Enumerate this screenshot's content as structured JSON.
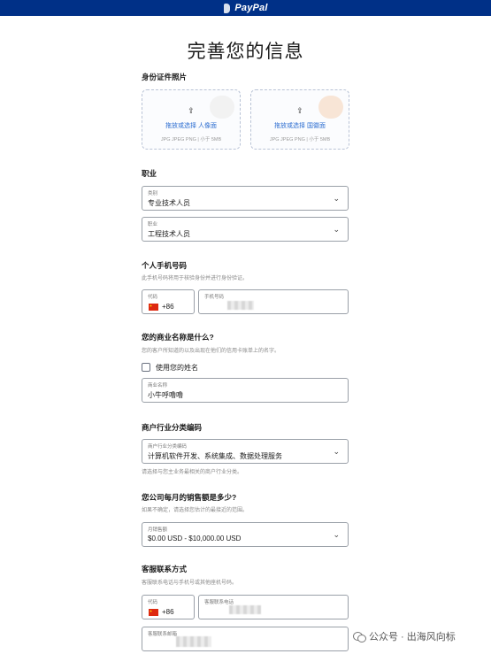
{
  "header": {
    "brand": "PayPal"
  },
  "page": {
    "title": "完善您的信息"
  },
  "id_photos": {
    "label": "身份证件照片",
    "front": {
      "link": "拖放或选择 人像面",
      "hint": "JPG JPEG PNG | 小于 5MB"
    },
    "back": {
      "link": "拖放或选择 国徽面",
      "hint": "JPG JPEG PNG | 小于 5MB"
    }
  },
  "occupation": {
    "label": "职业",
    "category": {
      "label": "类别",
      "value": "专业技术人员"
    },
    "job": {
      "label": "职业",
      "value": "工程技术人员"
    }
  },
  "phone": {
    "label": "个人手机号码",
    "helper": "此手机号码将用于核验身份并进行身份验证。",
    "code_label": "代码",
    "code_value": "+86",
    "number_label": "手机号码"
  },
  "business_name": {
    "label": "您的商业名称是什么?",
    "helper": "您的客户所知道的以及出现在他们的信用卡账单上的名字。",
    "checkbox_label": "使用您的姓名",
    "field_label": "商业名称",
    "field_value": "小牛呼噜噜"
  },
  "industry": {
    "label": "商户行业分类编码",
    "field_label": "商户行业分类编码",
    "field_value": "计算机软件开发、系统集成、数据处理服务",
    "helper": "请选择与您主业务最相关的商户行业分类。"
  },
  "sales": {
    "label": "您公司每月的销售额是多少?",
    "helper": "如果不确定，请选择您估计的最接近的范围。",
    "field_label": "月销售额",
    "field_value": "$0.00 USD - $10,000.00 USD"
  },
  "support": {
    "label": "客服联系方式",
    "helper": "客服联系电话与手机号或其他座机号码。",
    "code_label": "代码",
    "code_value": "+86",
    "phone_label": "客服联系电话",
    "email_label": "客服联系邮箱"
  },
  "watermark": {
    "text": "公众号 · 出海风向标"
  },
  "icons": {
    "upload": "upload-icon",
    "chevron": "chevron-down-icon",
    "flag": "china-flag-icon"
  }
}
